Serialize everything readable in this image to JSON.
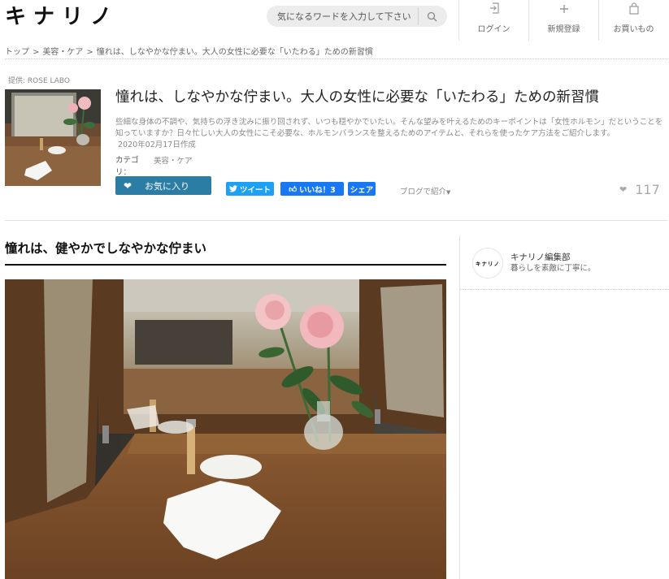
{
  "header": {
    "logo": "キナリノ",
    "search_placeholder": "気になるワードを入力して下さい",
    "nav": [
      {
        "label": "ログイン",
        "icon": "login-icon"
      },
      {
        "label": "新規登録",
        "icon": "plus-icon"
      },
      {
        "label": "お買いもの",
        "icon": "shopping-bag-icon"
      }
    ]
  },
  "breadcrumb": [
    "トップ",
    "美容・ケア",
    "憧れは、しなやかな佇まい。大人の女性に必要な「いたわる」ための新習慣"
  ],
  "breadcrumb_sep": ">",
  "article": {
    "provider": "提供: ROSE LABO",
    "title": "憧れは、しなやかな佇まい。大人の女性に必要な「いたわる」ための新習慣",
    "description": "些細な身体の不調や、気持ちの浮き沈みに振り回されず、いつも穏やかでいたい。そんな望みを叶えるためのキーポイントは「女性ホルモン」だということを知っていますか？日々忙しい大人の女性にこそ必要な、ホルモンバランスを整えるためのアイテムと、それらを使ったケア方法をご紹介します。",
    "date": "2020年02月17日作成",
    "category_label": "カテゴリ：",
    "category_value": "美容・ケア",
    "favorite_label": "お気に入り",
    "tweet_label": "ツイート",
    "fb_like_label": "いいね！3",
    "fb_share_label": "シェア",
    "blog_label": "ブログで紹介",
    "like_count": "117"
  },
  "section": {
    "title": "憧れは、健やかでしなやかな佇まい"
  },
  "sidebar": {
    "avatar_text": "キナリノ",
    "author_name": "キナリノ編集部",
    "author_desc": "暮らしを素敵に丁寧に。"
  },
  "colors": {
    "accent": "#2b7da6",
    "twitter": "#1da1f2",
    "facebook": "#1877f2"
  }
}
